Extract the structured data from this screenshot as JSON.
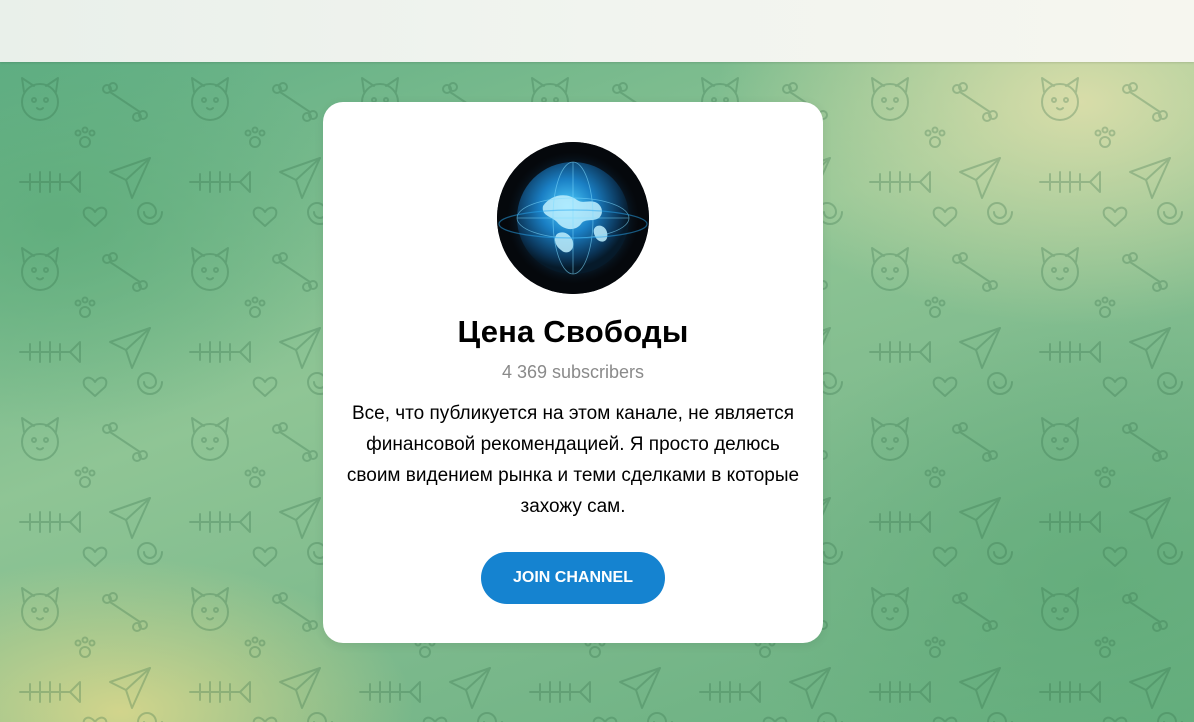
{
  "channel": {
    "title": "Цена Свободы",
    "subscribers": "4 369 subscribers",
    "description": "Все, что публикуется на этом канале, не является финансовой рекомендацией. Я просто делюсь своим видением рынка и теми сделками в которые захожу сам.",
    "avatar_icon": "globe-icon"
  },
  "actions": {
    "join_label": "JOIN CHANNEL"
  },
  "colors": {
    "button": "#1583d0",
    "background_green": "#7ab88b",
    "background_yellow": "#dcdea9",
    "card": "#ffffff"
  }
}
